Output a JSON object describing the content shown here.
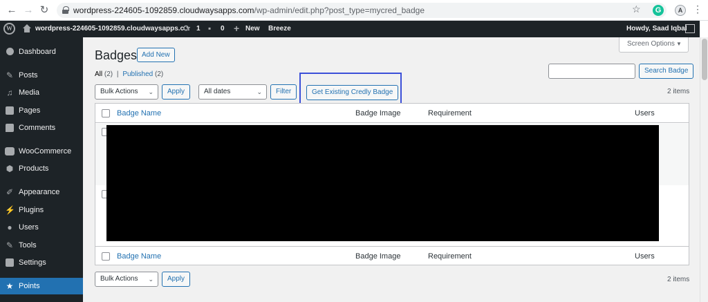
{
  "browser": {
    "url_host": "wordpress-224605-1092859.cloudwaysapps.com",
    "url_path": "/wp-admin/edit.php?post_type=mycred_badge",
    "profile_initial": "A",
    "extension_letter": "G"
  },
  "admin_bar": {
    "site_name": "wordpress-224605-1092859.cloudwaysapps.c...",
    "updates_count": "1",
    "comments_count": "0",
    "new_label": "New",
    "breeze_label": "Breeze",
    "greeting": "Howdy, Saad Iqbal"
  },
  "sidebar": {
    "items": [
      {
        "label": "Dashboard",
        "icon": "dashboard-icon"
      },
      {
        "label": "Posts",
        "icon": "pin-icon"
      },
      {
        "label": "Media",
        "icon": "media-icon"
      },
      {
        "label": "Pages",
        "icon": "pages-icon"
      },
      {
        "label": "Comments",
        "icon": "comments-icon"
      },
      {
        "label": "WooCommerce",
        "icon": "woocommerce-icon"
      },
      {
        "label": "Products",
        "icon": "products-icon"
      },
      {
        "label": "Appearance",
        "icon": "brush-icon"
      },
      {
        "label": "Plugins",
        "icon": "plugin-icon"
      },
      {
        "label": "Users",
        "icon": "users-icon"
      },
      {
        "label": "Tools",
        "icon": "wrench-icon"
      },
      {
        "label": "Settings",
        "icon": "settings-icon"
      },
      {
        "label": "Points",
        "icon": "star-icon",
        "active": true
      }
    ]
  },
  "page": {
    "title": "Badges",
    "add_new": "Add New",
    "screen_options": "Screen Options",
    "views": {
      "all": "All",
      "all_count": "(2)",
      "separator": "|",
      "published": "Published",
      "published_count": "(2)"
    },
    "search_button": "Search Badge",
    "bulk_actions": "Bulk Actions",
    "apply": "Apply",
    "all_dates": "All dates",
    "filter": "Filter",
    "get_credly": "Get Existing Credly Badge",
    "items_count": "2 items"
  },
  "table": {
    "columns": [
      "Badge Name",
      "Badge Image",
      "Requirement",
      "Users"
    ]
  },
  "colors": {
    "admin_dark": "#1d2327",
    "accent": "#2271b1",
    "highlight": "#3b4fd8"
  }
}
